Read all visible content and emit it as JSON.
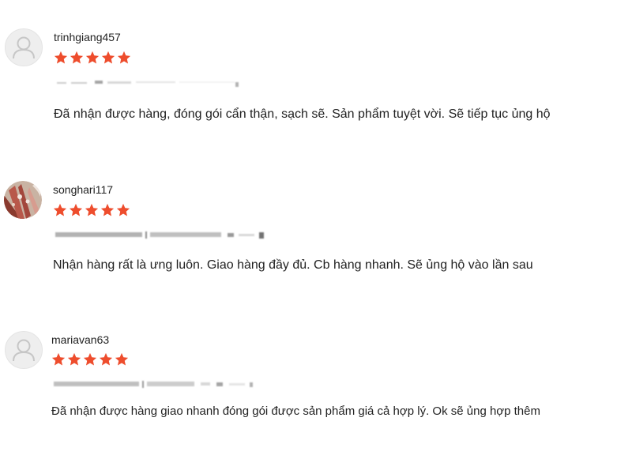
{
  "theme": {
    "star_color": "#ee4d2d",
    "text_color": "#222222",
    "meta_color": "#9a9a9a"
  },
  "reviews": [
    {
      "username": "trinhgiang457",
      "rating": 5,
      "avatar": "default-user-icon",
      "meta": "",
      "comment": "Đã nhận được hàng, đóng gói cẩn thận, sạch sẽ. Sản phẩm tuyệt vời. Sẽ tiếp tục ủng hộ"
    },
    {
      "username": "songhari117",
      "rating": 5,
      "avatar": "user-photo",
      "meta": "",
      "comment": "Nhận hàng rất là ưng luôn. Giao hàng đầy đủ. Cb hàng nhanh. Sẽ ủng hộ vào lần sau"
    },
    {
      "username": "mariavan63",
      "rating": 5,
      "avatar": "default-user-icon",
      "meta": "",
      "comment": "Đã nhận được hàng giao nhanh đóng gói được sản phẩm giá cả hợp lý. Ok sẽ ủng hợp thêm"
    }
  ]
}
